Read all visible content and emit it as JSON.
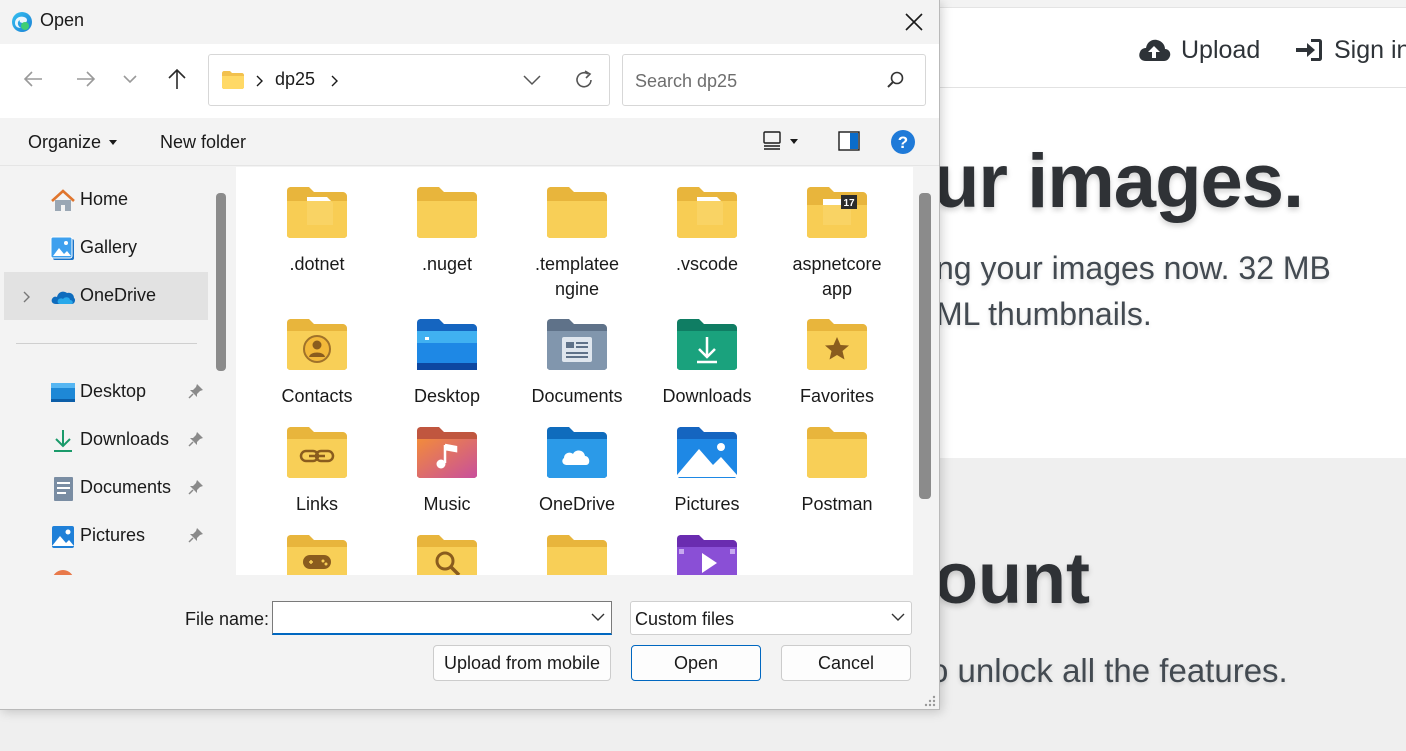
{
  "background_page": {
    "nav": {
      "upload_label": "Upload",
      "signin_label": "Sign in"
    },
    "hero": {
      "title": "ur images.",
      "subtitle_line1": "ng your images now. 32 MB",
      "subtitle_line2": "ML thumbnails."
    },
    "account": {
      "title": "ount",
      "subtitle": "o unlock all the features."
    }
  },
  "dialog": {
    "title": "Open",
    "breadcrumb": [
      "dp25"
    ],
    "search_placeholder": "Search dp25",
    "commands": {
      "organize": "Organize",
      "new_folder": "New folder"
    },
    "nav_items": [
      {
        "label": "Home",
        "icon": "home-icon"
      },
      {
        "label": "Gallery",
        "icon": "gallery-icon"
      },
      {
        "label": "OneDrive",
        "icon": "onedrive-icon",
        "selected": true
      },
      {
        "label": "Desktop",
        "icon": "desktop-icon",
        "pinned": true
      },
      {
        "label": "Downloads",
        "icon": "downloads-icon",
        "pinned": true
      },
      {
        "label": "Documents",
        "icon": "documents-icon",
        "pinned": true
      },
      {
        "label": "Pictures",
        "icon": "pictures-icon",
        "pinned": true
      }
    ],
    "files": [
      {
        "name": ".dotnet",
        "icon": "folder-icon"
      },
      {
        "name": ".nuget",
        "icon": "folder-icon"
      },
      {
        "name": ".templateengine",
        "line1": ".templatee",
        "line2": "ngine",
        "icon": "folder-icon"
      },
      {
        "name": ".vscode",
        "icon": "folder-icon"
      },
      {
        "name": "aspnetcoreapp",
        "line1": "aspnetcore",
        "line2": "app",
        "icon": "folder-icon"
      },
      {
        "name": "Contacts",
        "icon": "contacts-folder-icon"
      },
      {
        "name": "Desktop",
        "icon": "desktop-folder-icon"
      },
      {
        "name": "Documents",
        "icon": "documents-folder-icon"
      },
      {
        "name": "Downloads",
        "icon": "downloads-folder-icon"
      },
      {
        "name": "Favorites",
        "icon": "favorites-folder-icon"
      },
      {
        "name": "Links",
        "icon": "links-folder-icon"
      },
      {
        "name": "Music",
        "icon": "music-folder-icon"
      },
      {
        "name": "OneDrive",
        "icon": "onedrive-folder-icon"
      },
      {
        "name": "Pictures",
        "icon": "pictures-folder-icon"
      },
      {
        "name": "Postman",
        "icon": "folder-icon"
      }
    ],
    "badge_17": "17",
    "file_name_label": "File name:",
    "file_name_value": "",
    "file_type": "Custom files",
    "buttons": {
      "upload_mobile": "Upload from mobile",
      "open": "Open",
      "cancel": "Cancel"
    },
    "colors": {
      "accent": "#0067c0",
      "folder": "#f8cf57",
      "folder_dark": "#e8b53c"
    }
  }
}
